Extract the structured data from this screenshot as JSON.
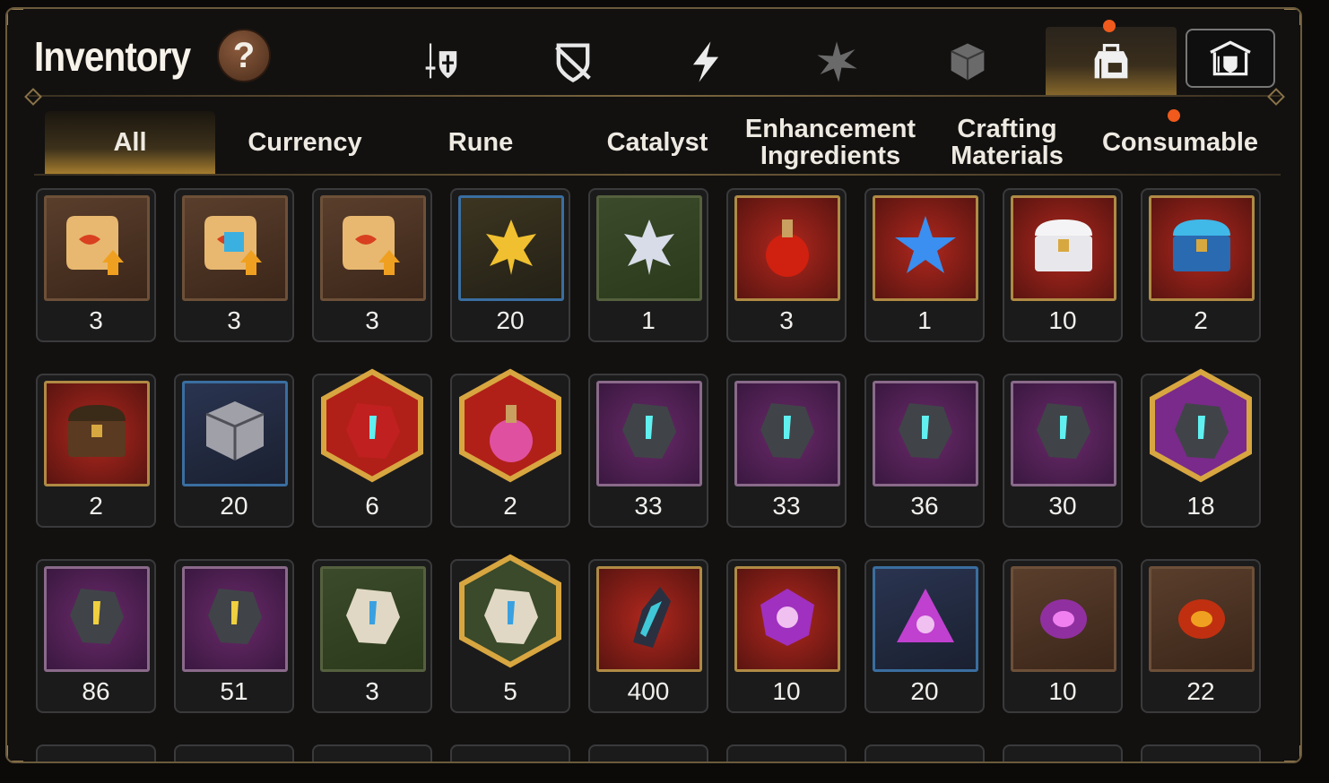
{
  "header": {
    "title": "Inventory",
    "help_label": "?"
  },
  "category_icons": [
    {
      "name": "equipment-icon",
      "active": false
    },
    {
      "name": "no-shield-icon",
      "active": false
    },
    {
      "name": "lightning-icon",
      "active": false
    },
    {
      "name": "sparkle-artifact-icon",
      "active": false
    },
    {
      "name": "cube-icon",
      "active": false
    },
    {
      "name": "backpack-icon",
      "active": true,
      "notification": true
    }
  ],
  "defense_icon": "defense-banner-icon",
  "tabs": [
    {
      "label": "All",
      "active": true
    },
    {
      "label": "Currency",
      "active": false
    },
    {
      "label": "Rune",
      "active": false
    },
    {
      "label": "Catalyst",
      "active": false
    },
    {
      "label": "Enhancement Ingredients",
      "active": false
    },
    {
      "label": "Crafting Materials",
      "active": false
    },
    {
      "label": "Consumable",
      "active": false,
      "notification": true
    }
  ],
  "items": [
    {
      "icon": "scroll-upgrade-icon",
      "frame": "brown",
      "count": "3"
    },
    {
      "icon": "scroll-rainbow-upgrade-icon",
      "frame": "brown",
      "count": "3"
    },
    {
      "icon": "scroll-upgrade-icon",
      "frame": "brown",
      "count": "3"
    },
    {
      "icon": "gold-flower-icon",
      "frame": "blue",
      "count": "20"
    },
    {
      "icon": "silver-flower-icon",
      "frame": "green",
      "count": "1"
    },
    {
      "icon": "red-potion-icon",
      "frame": "red",
      "count": "3"
    },
    {
      "icon": "star-potion-icon",
      "frame": "red",
      "count": "1"
    },
    {
      "icon": "white-chest-icon",
      "frame": "red",
      "count": "10"
    },
    {
      "icon": "blue-chest-icon",
      "frame": "red",
      "count": "2"
    },
    {
      "icon": "gold-chest-icon",
      "frame": "red",
      "count": "2"
    },
    {
      "icon": "silver-box-icon",
      "frame": "bluedark",
      "count": "20"
    },
    {
      "icon": "red-rune-stone-icon",
      "frame": "hex-red",
      "count": "6"
    },
    {
      "icon": "pink-potion-icon",
      "frame": "hex-red",
      "count": "2"
    },
    {
      "icon": "sword-rune-stone-icon",
      "frame": "purple",
      "count": "33"
    },
    {
      "icon": "spiral-rune-stone-icon",
      "frame": "purple",
      "count": "33"
    },
    {
      "icon": "helmet-rune-stone-icon",
      "frame": "purple",
      "count": "36"
    },
    {
      "icon": "boot-rune-stone-icon",
      "frame": "purple",
      "count": "30"
    },
    {
      "icon": "star-rune-stone-icon",
      "frame": "hex-purple",
      "count": "18"
    },
    {
      "icon": "hammer-rune-stone-icon",
      "frame": "purple",
      "count": "86"
    },
    {
      "icon": "bolt-rune-stone-icon",
      "frame": "purple",
      "count": "51"
    },
    {
      "icon": "sword-bone-stone-icon",
      "frame": "green",
      "count": "3"
    },
    {
      "icon": "star-bone-stone-icon",
      "frame": "hex-green",
      "count": "5"
    },
    {
      "icon": "dark-crystal-icon",
      "frame": "red",
      "count": "400"
    },
    {
      "icon": "pink-gem-icon",
      "frame": "red",
      "count": "10"
    },
    {
      "icon": "pink-triangle-gem-icon",
      "frame": "bluedark",
      "count": "20"
    },
    {
      "icon": "pink-orb-icon",
      "frame": "brown",
      "count": "10"
    },
    {
      "icon": "red-orb-icon",
      "frame": "brown",
      "count": "22"
    }
  ]
}
